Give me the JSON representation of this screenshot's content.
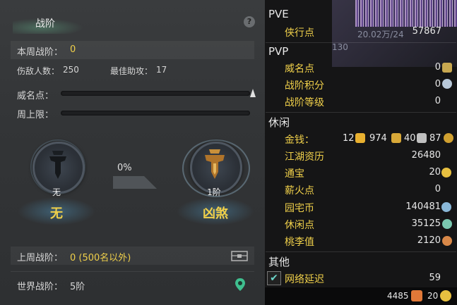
{
  "left_panel": {
    "title": "战阶",
    "help": "?",
    "weekly_rank_label": "本周战阶：",
    "weekly_rank_value": "0",
    "kills_label": "伤敌人数：",
    "kills_value": "250",
    "assists_label": "最佳助攻：",
    "assists_value": "17",
    "prestige_label": "威名点：",
    "weekly_cap_label": "周上限：",
    "current_rank": {
      "caption": "无",
      "name": "无"
    },
    "progress_percent": "0%",
    "next_rank": {
      "caption": "1阶",
      "name": "凶煞"
    },
    "last_week_label": "上周战阶：",
    "last_week_value": "0 (500名以外)",
    "world_rank_label": "世界战阶：",
    "world_rank_value": "5阶"
  },
  "right_panel": {
    "bg_text_1": "20.02万/24",
    "bg_text_2": "130",
    "pve": {
      "heading": "PVE",
      "items": [
        {
          "label": "侠行点",
          "value": "57867"
        }
      ]
    },
    "pvp": {
      "heading": "PVP",
      "items": [
        {
          "label": "威名点",
          "value": "0"
        },
        {
          "label": "战阶积分",
          "value": "0"
        },
        {
          "label": "战阶等级",
          "value": "0"
        }
      ]
    },
    "leisure": {
      "heading": "休闲",
      "money_label": "金钱：",
      "money_gold": "12",
      "money_silver": "974",
      "money_copper": "40",
      "money_wen": "87",
      "items": [
        {
          "label": "江湖资历",
          "value": "26480"
        },
        {
          "label": "通宝",
          "value": "20"
        },
        {
          "label": "薪火点",
          "value": "0"
        },
        {
          "label": "园宅币",
          "value": "140481"
        },
        {
          "label": "休闲点",
          "value": "35125"
        },
        {
          "label": "桃李值",
          "value": "2120"
        }
      ]
    },
    "other": {
      "heading": "其他",
      "latency_label": "网络延迟",
      "latency_value": "59"
    },
    "bottom": {
      "points": "4485",
      "coins": "20"
    }
  },
  "colors": {
    "accent_yellow": "#f0d04a",
    "teal": "#6cd4c8"
  }
}
